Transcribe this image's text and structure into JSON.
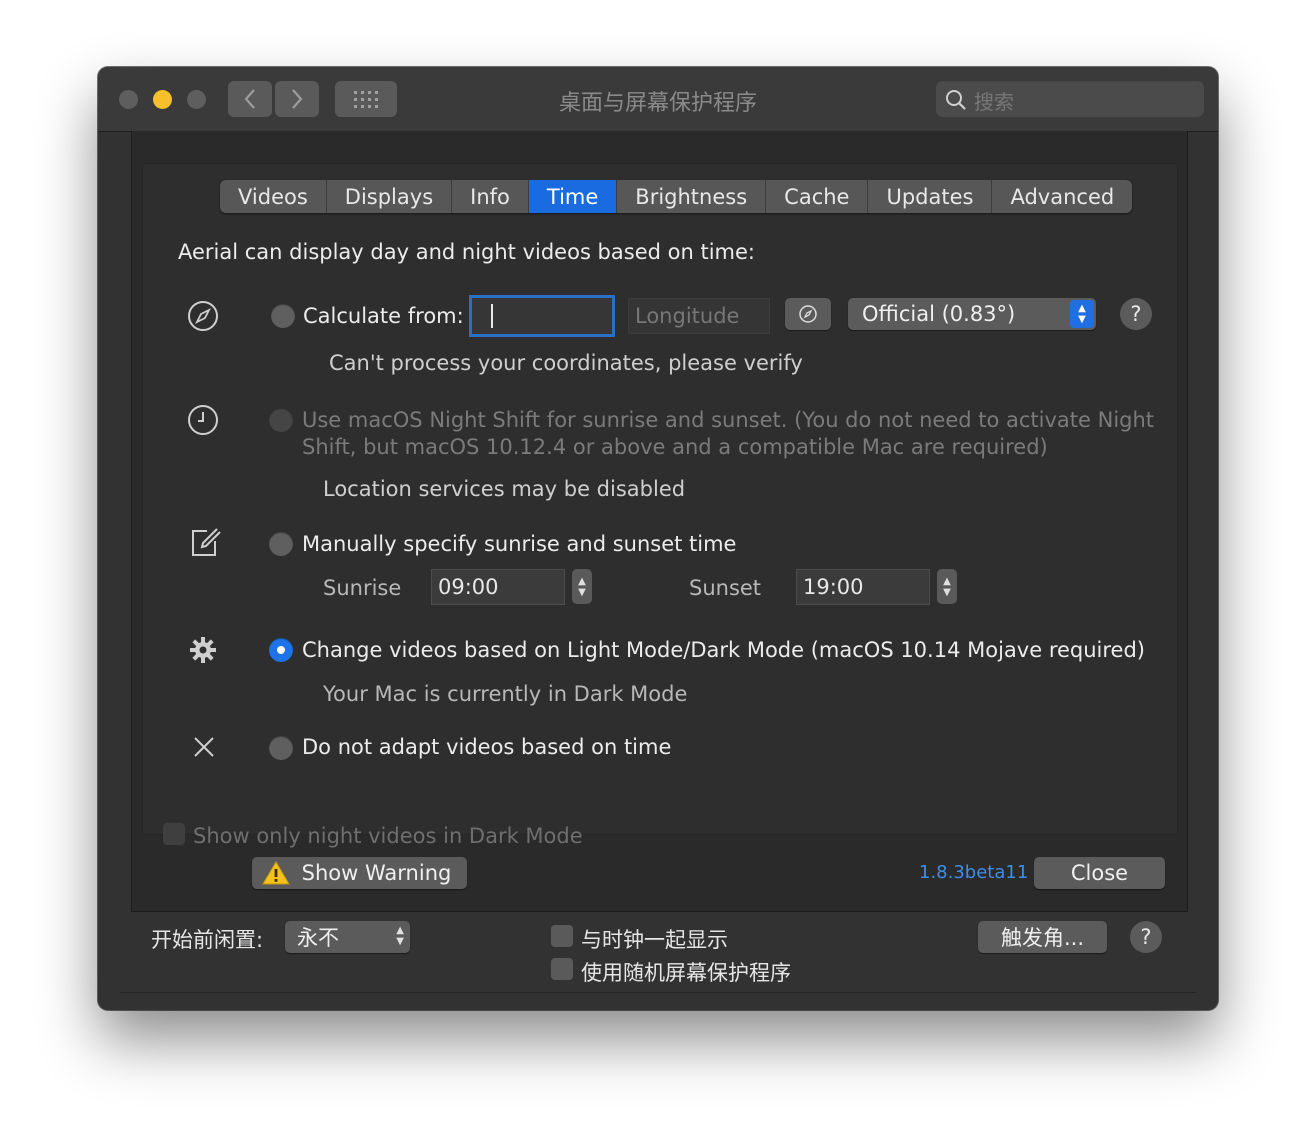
{
  "window": {
    "title": "桌面与屏幕保护程序",
    "search_placeholder": "搜索"
  },
  "tabs": [
    {
      "label": "Videos",
      "active": false
    },
    {
      "label": "Displays",
      "active": false
    },
    {
      "label": "Info",
      "active": false
    },
    {
      "label": "Time",
      "active": true
    },
    {
      "label": "Brightness",
      "active": false
    },
    {
      "label": "Cache",
      "active": false
    },
    {
      "label": "Updates",
      "active": false
    },
    {
      "label": "Advanced",
      "active": false
    }
  ],
  "time_panel": {
    "intro": "Aerial can display day and night videos based on time:",
    "calculate": {
      "label": "Calculate from:",
      "latitude_value": "",
      "longitude_placeholder": "Longitude",
      "mode_value": "Official (0.83°)",
      "status": "Can't process your coordinates, please verify"
    },
    "night_shift": {
      "label_line1": "Use macOS Night Shift for sunrise and sunset. (You do not need to activate Night",
      "label_line2": "Shift, but macOS 10.12.4 or above and a compatible Mac are required)",
      "status": "Location services may be disabled"
    },
    "manual": {
      "label": "Manually specify sunrise and sunset time",
      "sunrise_label": "Sunrise",
      "sunrise_value": "09:00",
      "sunset_label": "Sunset",
      "sunset_value": "19:00"
    },
    "dark_mode": {
      "label": "Change videos based on Light Mode/Dark Mode (macOS 10.14 Mojave required)",
      "status": "Your Mac is currently in Dark Mode",
      "selected": true
    },
    "no_adapt": {
      "label": "Do not adapt videos based on time"
    },
    "night_only_checkbox": "Show only night videos in Dark Mode"
  },
  "footer": {
    "show_warning": "Show Warning",
    "version": "1.8.3beta11",
    "close": "Close"
  },
  "bottom_bar": {
    "idle_label": "开始前闲置:",
    "idle_value": "永不",
    "show_clock": "与时钟一起显示",
    "random_saver": "使用随机屏幕保护程序",
    "hot_corners": "触发角...",
    "help": "?"
  },
  "help_label": "?",
  "colors": {
    "accent": "#1a6be0",
    "version_link": "#3d8ee8",
    "traffic_close": "#5e5e5e",
    "traffic_minimize": "#f6c02c",
    "traffic_zoom": "#5e5e5e"
  }
}
